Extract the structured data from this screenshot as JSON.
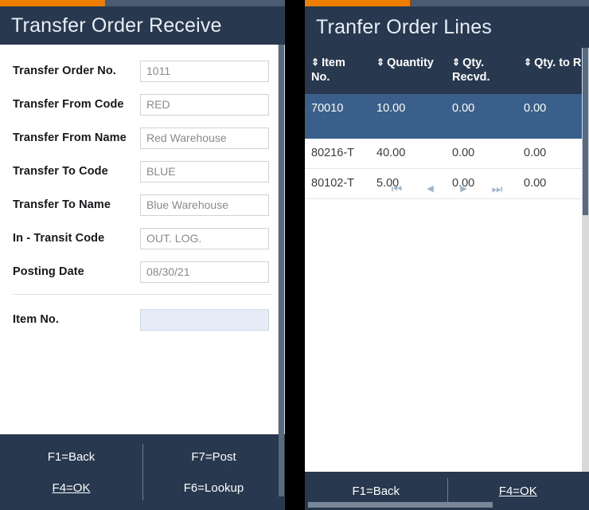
{
  "left_panel": {
    "progress_percent": 37,
    "title": "Transfer Order Receive",
    "fields": [
      {
        "label": "Transfer Order No.",
        "value": "1011"
      },
      {
        "label": "Transfer From Code",
        "value": "RED"
      },
      {
        "label": "Transfer From Name",
        "value": "Red Warehouse"
      },
      {
        "label": "Transfer To Code",
        "value": "BLUE"
      },
      {
        "label": "Transfer To Name",
        "value": "Blue Warehouse"
      },
      {
        "label": "In - Transit Code",
        "value": "OUT. LOG."
      },
      {
        "label": "Posting Date",
        "value": "08/30/21"
      }
    ],
    "item_field": {
      "label": "Item No.",
      "value": ""
    },
    "footer_keys": [
      {
        "label": "F1=Back",
        "underline": false
      },
      {
        "label": "F7=Post",
        "underline": false
      },
      {
        "label": "F4=OK",
        "underline": true
      },
      {
        "label": "F6=Lookup",
        "underline": false
      }
    ]
  },
  "right_panel": {
    "progress_percent": 37,
    "title": "Tranfer Order Lines",
    "sort_icon": "sort-updown-icon",
    "table": {
      "columns": [
        "Item No.",
        "Quantity",
        "Qty. Recvd.",
        "Qty. to Receive"
      ],
      "rows": [
        {
          "item_no": "70010",
          "quantity": "10.00",
          "qty_recvd": "0.00",
          "qty_to_receive": "0.00",
          "selected": true
        },
        {
          "item_no": "80216-T",
          "quantity": "40.00",
          "qty_recvd": "0.00",
          "qty_to_receive": "0.00",
          "selected": false
        },
        {
          "item_no": "80102-T",
          "quantity": "5.00",
          "qty_recvd": "0.00",
          "qty_to_receive": "0.00",
          "selected": false
        }
      ]
    },
    "pager": {
      "first": "⏮",
      "prev": "◀",
      "next": "▶",
      "last": "⏭"
    },
    "footer_keys": [
      {
        "label": "F1=Back",
        "underline": false
      },
      {
        "label": "F4=OK",
        "underline": true
      }
    ]
  },
  "colors": {
    "accent_orange": "#ef7d00",
    "header_navy": "#27384f",
    "row_selected_blue": "#3a5f8a",
    "focus_field_blue": "#e6edf8"
  }
}
